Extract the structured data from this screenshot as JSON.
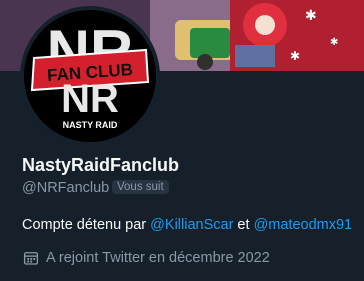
{
  "profile": {
    "display_name": "NastyRaidFanclub",
    "handle": "@NRFanclub",
    "follows_you_badge": "Vous suit",
    "bio_prefix": "Compte détenu par ",
    "bio_mention_1": "@KillianScar",
    "bio_connector": " et ",
    "bio_mention_2": "@mateodmx91",
    "joined_text": "A rejoint Twitter en décembre 2022"
  },
  "avatar": {
    "logo_text_top": "NR",
    "logo_text_band": "FAN CLUB",
    "logo_text_bottom": "NASTY RAID"
  },
  "icons": {
    "joined": "calendar-icon"
  },
  "colors": {
    "background": "#15202b",
    "link": "#1d9bf0",
    "secondary_text": "#8b98a5",
    "badge_bg": "#273340",
    "logo_red": "#d4202c"
  }
}
